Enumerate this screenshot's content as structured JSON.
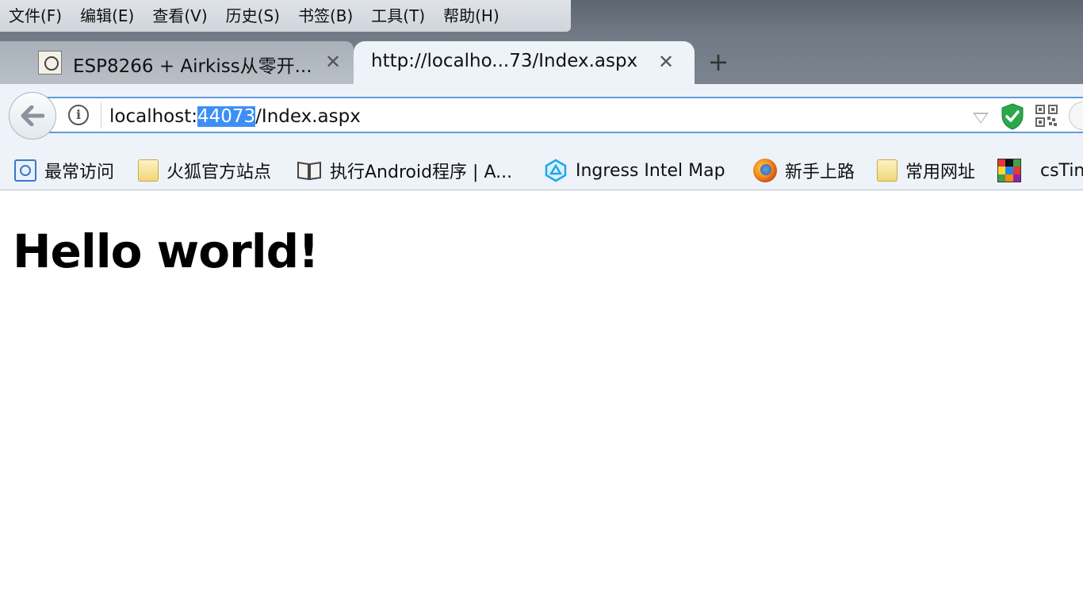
{
  "menubar": {
    "items": [
      "文件(F)",
      "编辑(E)",
      "查看(V)",
      "历史(S)",
      "书签(B)",
      "工具(T)",
      "帮助(H)"
    ]
  },
  "tabs": [
    {
      "title": "ESP8266 + Airkiss从零开...",
      "active": false,
      "close": "✕"
    },
    {
      "title": "http://localho...73/Index.aspx",
      "active": true,
      "close": "✕"
    }
  ],
  "new_tab_label": "+",
  "urlbar": {
    "url_prefix": "localhost:",
    "url_selected": "44073",
    "url_suffix": "/Index.aspx",
    "info_label": "i"
  },
  "bookmarks": [
    {
      "label": "最常访问",
      "icon": "smart-bookmark-icon"
    },
    {
      "label": "火狐官方站点",
      "icon": "folder-icon"
    },
    {
      "label": "执行Android程序 | A...",
      "icon": "book-icon"
    },
    {
      "label": "Ingress Intel Map",
      "icon": "ingress-icon"
    },
    {
      "label": "新手上路",
      "icon": "firefox-icon"
    },
    {
      "label": "常用网址",
      "icon": "folder-icon"
    },
    {
      "label": "csTin",
      "icon": "cstiny-icon"
    }
  ],
  "page": {
    "heading": "Hello world!"
  },
  "colors": {
    "selection": "#3d8ff5",
    "urlbar_border": "#5f9be0",
    "toolbar_bg": "#eef3f9",
    "shield_green": "#2aa84a"
  }
}
